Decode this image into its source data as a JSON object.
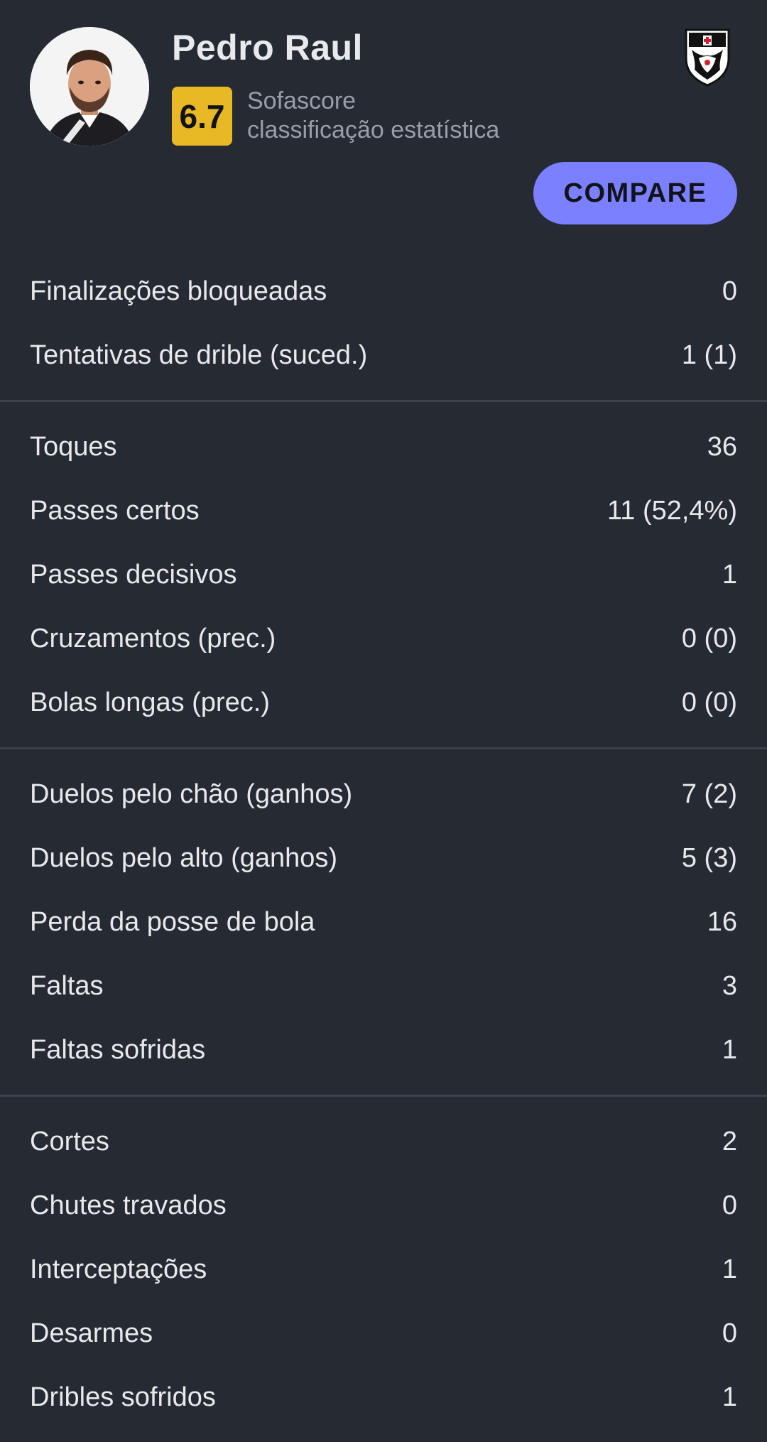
{
  "player": {
    "name": "Pedro Raul",
    "rating": "6.7",
    "rating_label_line1": "Sofascore",
    "rating_label_line2": "classificação estatística",
    "photo_icon": "player-photo",
    "club_icon": "vasco-crest-icon"
  },
  "actions": {
    "compare_label": "COMPARE"
  },
  "colors": {
    "background": "#262a33",
    "rating_badge": "#e8b825",
    "compare_button": "#7a80ff",
    "divider": "#3d424d"
  },
  "stat_groups": [
    {
      "rows": [
        {
          "label": "Finalizações bloqueadas",
          "value": "0"
        },
        {
          "label": "Tentativas de drible (suced.)",
          "value": "1 (1)"
        }
      ]
    },
    {
      "rows": [
        {
          "label": "Toques",
          "value": "36"
        },
        {
          "label": "Passes certos",
          "value": "11 (52,4%)"
        },
        {
          "label": "Passes decisivos",
          "value": "1"
        },
        {
          "label": "Cruzamentos (prec.)",
          "value": "0 (0)"
        },
        {
          "label": "Bolas longas (prec.)",
          "value": "0 (0)"
        }
      ]
    },
    {
      "rows": [
        {
          "label": "Duelos pelo chão (ganhos)",
          "value": "7 (2)"
        },
        {
          "label": "Duelos pelo alto (ganhos)",
          "value": "5 (3)"
        },
        {
          "label": "Perda da posse de bola",
          "value": "16"
        },
        {
          "label": "Faltas",
          "value": "3"
        },
        {
          "label": "Faltas sofridas",
          "value": "1"
        }
      ]
    },
    {
      "rows": [
        {
          "label": "Cortes",
          "value": "2"
        },
        {
          "label": "Chutes travados",
          "value": "0"
        },
        {
          "label": "Interceptações",
          "value": "1"
        },
        {
          "label": "Desarmes",
          "value": "0"
        },
        {
          "label": "Dribles sofridos",
          "value": "1"
        }
      ]
    }
  ]
}
